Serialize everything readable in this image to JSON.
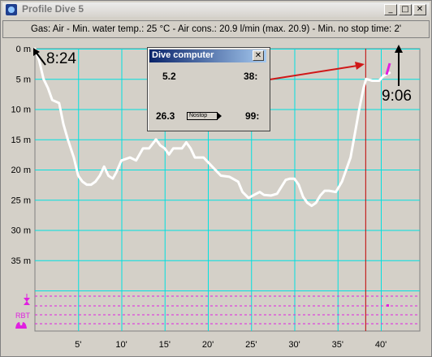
{
  "window": {
    "title": "Profile Dive 5",
    "icon": "dive-app-icon"
  },
  "info": "Gas: Air  -  Min. water temp.: 25 °C  -  Air cons.: 20.9 l/min (max. 20.9)  -  Min. no stop time: 2'",
  "dive_computer": {
    "title": "Dive computer",
    "depth": "5.2",
    "elapsed": "38:",
    "temp": "26.3",
    "status": "Nostop",
    "ndl": "99:"
  },
  "labels": {
    "start_time": "8:24",
    "end_time": "9:06",
    "rbt": "RBT"
  },
  "chart_data": {
    "type": "line",
    "title": "",
    "xlabel": "",
    "ylabel": "",
    "x_ticks": [
      "5'",
      "10'",
      "15'",
      "20'",
      "25'",
      "30'",
      "35'",
      "40'"
    ],
    "y_ticks": [
      "0 m",
      "5 m",
      "10 m",
      "15 m",
      "20 m",
      "25 m",
      "30 m",
      "35 m"
    ],
    "xlim": [
      0,
      42
    ],
    "ylim": [
      0,
      40
    ],
    "grid": true,
    "cursor_minute": 38.2,
    "series": [
      {
        "color": "#ffffff",
        "points": [
          [
            0,
            0
          ],
          [
            0.5,
            2
          ],
          [
            1,
            5
          ],
          [
            1.5,
            6.5
          ],
          [
            2,
            8.5
          ],
          [
            2.8,
            9
          ],
          [
            3.3,
            12.5
          ],
          [
            3.8,
            15
          ],
          [
            4.5,
            18
          ],
          [
            5,
            21
          ],
          [
            5.5,
            22
          ],
          [
            6,
            22.5
          ],
          [
            6.5,
            22.5
          ],
          [
            7,
            22
          ],
          [
            7.5,
            21
          ],
          [
            8,
            19.5
          ],
          [
            8.5,
            21
          ],
          [
            9,
            21.5
          ],
          [
            9.4,
            20.5
          ],
          [
            10,
            18.5
          ],
          [
            11,
            18
          ],
          [
            11.7,
            18.5
          ],
          [
            12.5,
            16.5
          ],
          [
            13.2,
            16.5
          ],
          [
            14,
            15
          ],
          [
            14.5,
            16
          ],
          [
            15,
            16.5
          ],
          [
            15.5,
            17.5
          ],
          [
            16,
            16.5
          ],
          [
            17,
            16.5
          ],
          [
            17.5,
            15.5
          ],
          [
            18,
            16.5
          ],
          [
            18.5,
            18
          ],
          [
            19.5,
            18
          ],
          [
            20.5,
            19.5
          ],
          [
            21.5,
            21
          ],
          [
            22.5,
            21.2
          ],
          [
            23.5,
            22
          ],
          [
            24,
            23.7
          ],
          [
            24.7,
            24.7
          ],
          [
            25.2,
            24.3
          ],
          [
            26,
            23.7
          ],
          [
            26.5,
            24.2
          ],
          [
            27.3,
            24.3
          ],
          [
            28,
            24
          ],
          [
            29,
            21.7
          ],
          [
            29.5,
            21.5
          ],
          [
            30,
            21.5
          ],
          [
            30.5,
            22.5
          ],
          [
            31,
            24.5
          ],
          [
            31.5,
            25.5
          ],
          [
            32,
            26
          ],
          [
            32.5,
            25.5
          ],
          [
            33,
            24.3
          ],
          [
            33.5,
            23.5
          ],
          [
            34,
            23.5
          ],
          [
            34.8,
            23.7
          ],
          [
            35.5,
            22
          ],
          [
            36,
            20
          ],
          [
            36.5,
            18
          ],
          [
            37,
            14
          ],
          [
            37.5,
            10
          ],
          [
            38,
            6.5
          ],
          [
            38.3,
            5
          ],
          [
            39,
            5.3
          ],
          [
            39.8,
            5.3
          ],
          [
            40.3,
            4.5
          ],
          [
            41,
            4
          ]
        ]
      }
    ]
  },
  "annotation_colors": {
    "plot_bg": "#d4d0c8",
    "grid": "#00e0e0",
    "profile": "#ffffff",
    "cursor": "#c00000",
    "deco_lines": "#e020e0",
    "arrow": "#d01818"
  }
}
